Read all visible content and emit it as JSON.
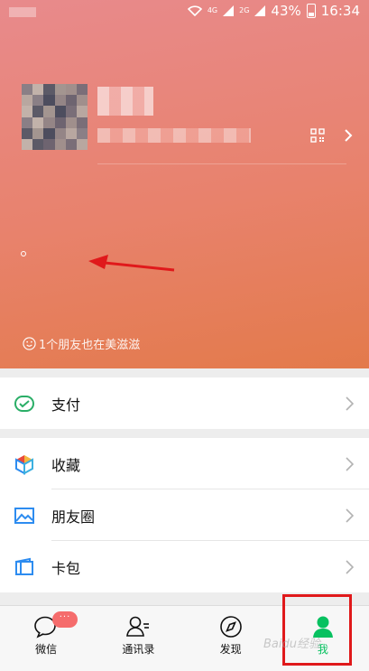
{
  "status_bar": {
    "network_labels": [
      "4G",
      "2G"
    ],
    "battery": "43%",
    "time": "16:34"
  },
  "profile": {
    "friends_notice": "1个朋友也在美滋滋"
  },
  "menu": [
    {
      "name": "pay",
      "label": "支付",
      "icon": "wallet-icon"
    },
    {
      "name": "favorites",
      "label": "收藏",
      "icon": "cube-icon"
    },
    {
      "name": "moments",
      "label": "朋友圈",
      "icon": "image-icon"
    },
    {
      "name": "cards",
      "label": "卡包",
      "icon": "card-icon"
    }
  ],
  "tabbar": {
    "tabs": [
      {
        "label": "微信",
        "icon": "chat-bubble-icon"
      },
      {
        "label": "通讯录",
        "icon": "contacts-icon"
      },
      {
        "label": "发现",
        "icon": "compass-icon"
      },
      {
        "label": "我",
        "icon": "person-icon",
        "active": true
      }
    ],
    "badge": "···"
  },
  "colors": {
    "accent": "#07c160",
    "hero_top": "#e88a8c",
    "hero_bottom": "#e37a4b",
    "highlight": "#e0191b"
  },
  "watermark": "Baidu经验"
}
